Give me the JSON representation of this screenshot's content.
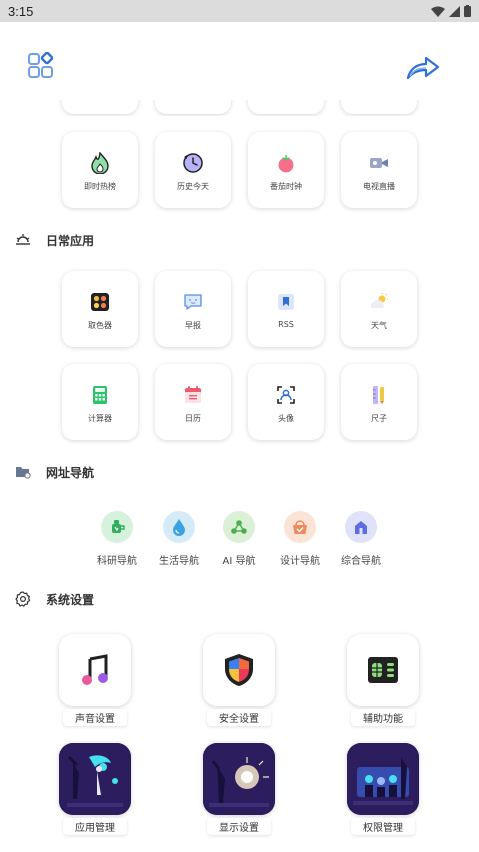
{
  "status_bar": {
    "time": "3:15"
  },
  "header": {
    "menu_icon": "grid-diamond-icon",
    "share_icon": "share-arrow-icon"
  },
  "top_tools": [
    {
      "label": "即时热榜",
      "icon": "flame-icon"
    },
    {
      "label": "历史今天",
      "icon": "history-clock-icon"
    },
    {
      "label": "番茄时钟",
      "icon": "tomato-icon"
    },
    {
      "label": "电视直播",
      "icon": "tv-camera-icon"
    }
  ],
  "daily": {
    "title": "日常应用",
    "items": [
      {
        "label": "取色器",
        "icon": "color-picker-icon"
      },
      {
        "label": "早报",
        "icon": "chat-bubble-icon"
      },
      {
        "label": "RSS",
        "icon": "bookmark-icon"
      },
      {
        "label": "天气",
        "icon": "weather-icon"
      },
      {
        "label": "计算器",
        "icon": "calculator-icon"
      },
      {
        "label": "日历",
        "icon": "calendar-icon"
      },
      {
        "label": "头像",
        "icon": "avatar-icon"
      },
      {
        "label": "尺子",
        "icon": "ruler-icon"
      }
    ]
  },
  "nav": {
    "title": "网址导航",
    "items": [
      {
        "label": "科研导航",
        "icon": "flask-icon",
        "color": "#d6f2dc"
      },
      {
        "label": "生活导航",
        "icon": "water-drop-icon",
        "color": "#d5ecf8"
      },
      {
        "label": "AI 导航",
        "icon": "network-icon",
        "color": "#dcf0d8"
      },
      {
        "label": "设计导航",
        "icon": "basket-icon",
        "color": "#fbe3d6"
      },
      {
        "label": "综合导航",
        "icon": "home-icon",
        "color": "#dfe2f8"
      }
    ]
  },
  "system": {
    "title": "系统设置",
    "items": [
      {
        "label": "声音设置",
        "icon": "music-note-icon"
      },
      {
        "label": "安全设置",
        "icon": "shield-icon"
      },
      {
        "label": "辅助功能",
        "icon": "sim-card-icon"
      },
      {
        "label": "应用管理",
        "icon": "app-management-illustration"
      },
      {
        "label": "显示设置",
        "icon": "display-illustration"
      },
      {
        "label": "权限管理",
        "icon": "permission-illustration"
      }
    ]
  }
}
